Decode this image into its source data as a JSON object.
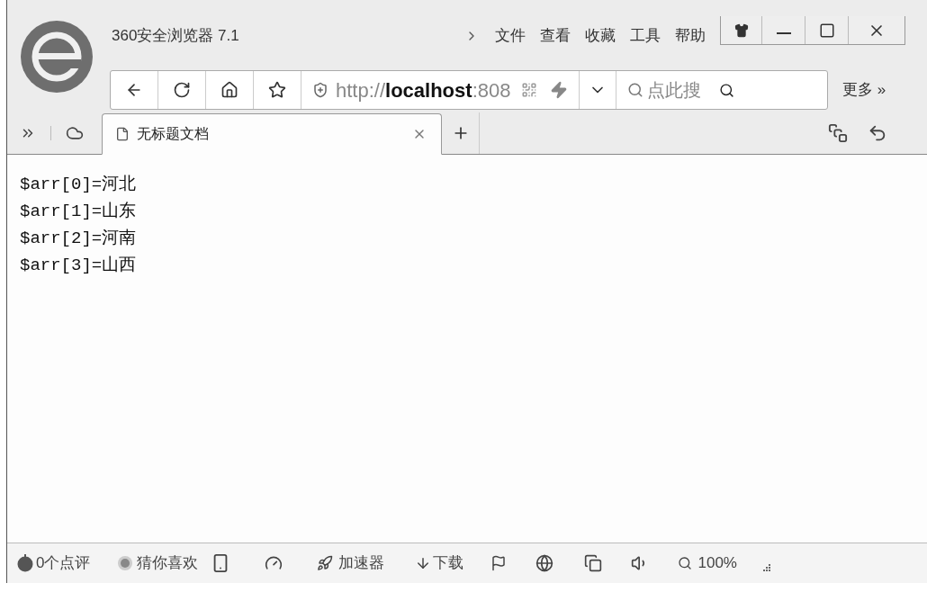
{
  "window": {
    "title": "360安全浏览器 7.1"
  },
  "menu": [
    {
      "label": "文件"
    },
    {
      "label": "查看"
    },
    {
      "label": "收藏"
    },
    {
      "label": "工具"
    },
    {
      "label": "帮助"
    }
  ],
  "address_bar": {
    "url": "http://**localhost**:808"
  },
  "search": {
    "placeholder": "点此搜"
  },
  "more_button": "更多 »",
  "tabs": [
    {
      "label": "无标题文档",
      "selected": true
    }
  ],
  "content": {
    "lines": [
      "$arr[0]=河北",
      "$arr[1]=山东",
      "$arr[2]=河南",
      "$arr[3]=山西"
    ]
  },
  "status_bar": {
    "reviews": "0个点评",
    "recommend": "猜你喜欢",
    "accelerator": "加速器",
    "download": "下载",
    "zoom": "100%"
  }
}
